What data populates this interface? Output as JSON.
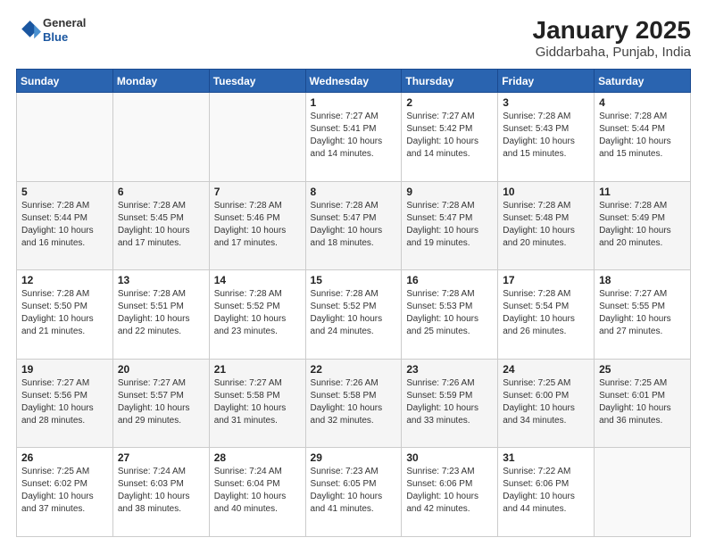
{
  "logo": {
    "general": "General",
    "blue": "Blue"
  },
  "title": "January 2025",
  "subtitle": "Giddarbaha, Punjab, India",
  "days_of_week": [
    "Sunday",
    "Monday",
    "Tuesday",
    "Wednesday",
    "Thursday",
    "Friday",
    "Saturday"
  ],
  "weeks": [
    [
      {
        "day": "",
        "info": ""
      },
      {
        "day": "",
        "info": ""
      },
      {
        "day": "",
        "info": ""
      },
      {
        "day": "1",
        "info": "Sunrise: 7:27 AM\nSunset: 5:41 PM\nDaylight: 10 hours\nand 14 minutes."
      },
      {
        "day": "2",
        "info": "Sunrise: 7:27 AM\nSunset: 5:42 PM\nDaylight: 10 hours\nand 14 minutes."
      },
      {
        "day": "3",
        "info": "Sunrise: 7:28 AM\nSunset: 5:43 PM\nDaylight: 10 hours\nand 15 minutes."
      },
      {
        "day": "4",
        "info": "Sunrise: 7:28 AM\nSunset: 5:44 PM\nDaylight: 10 hours\nand 15 minutes."
      }
    ],
    [
      {
        "day": "5",
        "info": "Sunrise: 7:28 AM\nSunset: 5:44 PM\nDaylight: 10 hours\nand 16 minutes."
      },
      {
        "day": "6",
        "info": "Sunrise: 7:28 AM\nSunset: 5:45 PM\nDaylight: 10 hours\nand 17 minutes."
      },
      {
        "day": "7",
        "info": "Sunrise: 7:28 AM\nSunset: 5:46 PM\nDaylight: 10 hours\nand 17 minutes."
      },
      {
        "day": "8",
        "info": "Sunrise: 7:28 AM\nSunset: 5:47 PM\nDaylight: 10 hours\nand 18 minutes."
      },
      {
        "day": "9",
        "info": "Sunrise: 7:28 AM\nSunset: 5:47 PM\nDaylight: 10 hours\nand 19 minutes."
      },
      {
        "day": "10",
        "info": "Sunrise: 7:28 AM\nSunset: 5:48 PM\nDaylight: 10 hours\nand 20 minutes."
      },
      {
        "day": "11",
        "info": "Sunrise: 7:28 AM\nSunset: 5:49 PM\nDaylight: 10 hours\nand 20 minutes."
      }
    ],
    [
      {
        "day": "12",
        "info": "Sunrise: 7:28 AM\nSunset: 5:50 PM\nDaylight: 10 hours\nand 21 minutes."
      },
      {
        "day": "13",
        "info": "Sunrise: 7:28 AM\nSunset: 5:51 PM\nDaylight: 10 hours\nand 22 minutes."
      },
      {
        "day": "14",
        "info": "Sunrise: 7:28 AM\nSunset: 5:52 PM\nDaylight: 10 hours\nand 23 minutes."
      },
      {
        "day": "15",
        "info": "Sunrise: 7:28 AM\nSunset: 5:52 PM\nDaylight: 10 hours\nand 24 minutes."
      },
      {
        "day": "16",
        "info": "Sunrise: 7:28 AM\nSunset: 5:53 PM\nDaylight: 10 hours\nand 25 minutes."
      },
      {
        "day": "17",
        "info": "Sunrise: 7:28 AM\nSunset: 5:54 PM\nDaylight: 10 hours\nand 26 minutes."
      },
      {
        "day": "18",
        "info": "Sunrise: 7:27 AM\nSunset: 5:55 PM\nDaylight: 10 hours\nand 27 minutes."
      }
    ],
    [
      {
        "day": "19",
        "info": "Sunrise: 7:27 AM\nSunset: 5:56 PM\nDaylight: 10 hours\nand 28 minutes."
      },
      {
        "day": "20",
        "info": "Sunrise: 7:27 AM\nSunset: 5:57 PM\nDaylight: 10 hours\nand 29 minutes."
      },
      {
        "day": "21",
        "info": "Sunrise: 7:27 AM\nSunset: 5:58 PM\nDaylight: 10 hours\nand 31 minutes."
      },
      {
        "day": "22",
        "info": "Sunrise: 7:26 AM\nSunset: 5:58 PM\nDaylight: 10 hours\nand 32 minutes."
      },
      {
        "day": "23",
        "info": "Sunrise: 7:26 AM\nSunset: 5:59 PM\nDaylight: 10 hours\nand 33 minutes."
      },
      {
        "day": "24",
        "info": "Sunrise: 7:25 AM\nSunset: 6:00 PM\nDaylight: 10 hours\nand 34 minutes."
      },
      {
        "day": "25",
        "info": "Sunrise: 7:25 AM\nSunset: 6:01 PM\nDaylight: 10 hours\nand 36 minutes."
      }
    ],
    [
      {
        "day": "26",
        "info": "Sunrise: 7:25 AM\nSunset: 6:02 PM\nDaylight: 10 hours\nand 37 minutes."
      },
      {
        "day": "27",
        "info": "Sunrise: 7:24 AM\nSunset: 6:03 PM\nDaylight: 10 hours\nand 38 minutes."
      },
      {
        "day": "28",
        "info": "Sunrise: 7:24 AM\nSunset: 6:04 PM\nDaylight: 10 hours\nand 40 minutes."
      },
      {
        "day": "29",
        "info": "Sunrise: 7:23 AM\nSunset: 6:05 PM\nDaylight: 10 hours\nand 41 minutes."
      },
      {
        "day": "30",
        "info": "Sunrise: 7:23 AM\nSunset: 6:06 PM\nDaylight: 10 hours\nand 42 minutes."
      },
      {
        "day": "31",
        "info": "Sunrise: 7:22 AM\nSunset: 6:06 PM\nDaylight: 10 hours\nand 44 minutes."
      },
      {
        "day": "",
        "info": ""
      }
    ]
  ]
}
